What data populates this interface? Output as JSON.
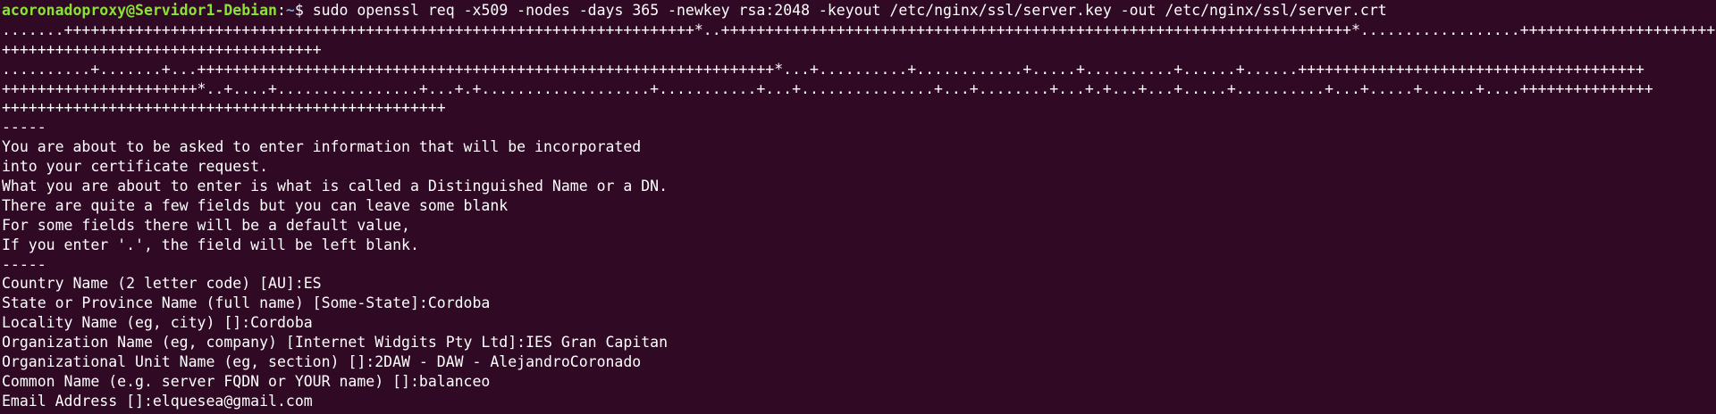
{
  "prompt": {
    "user_host": "acoronadoproxy@Servidor1-Debian",
    "separator": ":",
    "path": "~",
    "symbol": "$ ",
    "command": "sudo openssl req -x509 -nodes -days 365 -newkey rsa:2048 -keyout /etc/nginx/ssl/server.key -out /etc/nginx/ssl/server.crt"
  },
  "output_lines": [
    ".......+++++++++++++++++++++++++++++++++++++++++++++++++++++++++++++++++++++++*..+++++++++++++++++++++++++++++++++++++++++++++++++++++++++++++++++++++++*..................+++++++++++++++++++++++++++",
    "++++++++++++++++++++++++++++++++++++",
    "..........+.......+...+++++++++++++++++++++++++++++++++++++++++++++++++++++++++++++++++*...+..........+............+.....+..........+......+......+++++++++++++++++++++++++++++++++++++++",
    "++++++++++++++++++++++*..+....+................+...+.+...................+...........+...+...............+...+........+...+.+...+...+.....+..........+...+.....+......+....+++++++++++++++",
    "++++++++++++++++++++++++++++++++++++++++++++++++++",
    "-----",
    "You are about to be asked to enter information that will be incorporated",
    "into your certificate request.",
    "What you are about to enter is what is called a Distinguished Name or a DN.",
    "There are quite a few fields but you can leave some blank",
    "For some fields there will be a default value,",
    "If you enter '.', the field will be left blank.",
    "-----",
    "Country Name (2 letter code) [AU]:ES",
    "State or Province Name (full name) [Some-State]:Cordoba",
    "Locality Name (eg, city) []:Cordoba",
    "Organization Name (eg, company) [Internet Widgits Pty Ltd]:IES Gran Capitan",
    "Organizational Unit Name (eg, section) []:2DAW - DAW - AlejandroCoronado",
    "Common Name (e.g. server FQDN or YOUR name) []:balanceo",
    "Email Address []:elquesea@gmail.com"
  ],
  "colors": {
    "background": "#300a24",
    "text": "#ffffff",
    "user_host": "#8ae234",
    "path": "#729fcf"
  }
}
